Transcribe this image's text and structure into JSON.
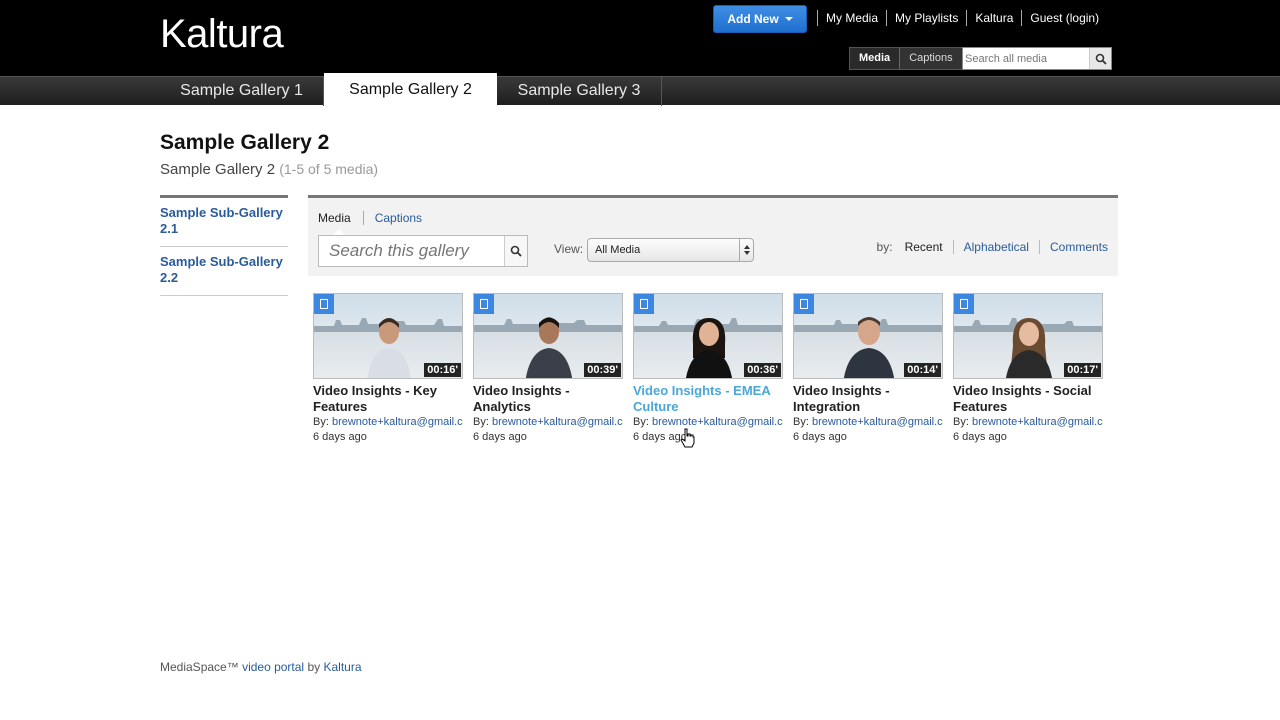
{
  "header": {
    "logo": "Kaltura",
    "add_new_label": "Add New",
    "links": [
      "My Media",
      "My Playlists",
      "Kaltura",
      "Guest (login)"
    ],
    "search_tabs": [
      "Media",
      "Captions"
    ],
    "search_placeholder": "Search all media"
  },
  "gallery_tabs": [
    "Sample Gallery 1",
    "Sample Gallery 2",
    "Sample Gallery 3"
  ],
  "page": {
    "title": "Sample Gallery 2",
    "subtitle": "Sample Gallery 2",
    "count": "(1-5 of 5 media)"
  },
  "sidebar": {
    "items": [
      "Sample Sub-Gallery 2.1",
      "Sample Sub-Gallery 2.2"
    ]
  },
  "toolbar": {
    "tabs": [
      "Media",
      "Captions"
    ],
    "search_placeholder": "Search this gallery",
    "view_label": "View:",
    "view_value": "All Media",
    "sort_label": "by:",
    "sort_options": [
      "Recent",
      "Alphabetical",
      "Comments"
    ]
  },
  "media": [
    {
      "title": "Video Insights - Key Features",
      "duration": "00:16'",
      "by_label": "By:",
      "author": "brewnote+kaltura@gmail.com",
      "ago": "6 days ago"
    },
    {
      "title": "Video Insights - Analytics",
      "duration": "00:39'",
      "by_label": "By:",
      "author": "brewnote+kaltura@gmail.com",
      "ago": "6 days ago"
    },
    {
      "title": "Video Insights - EMEA Culture",
      "duration": "00:36'",
      "by_label": "By:",
      "author": "brewnote+kaltura@gmail.com",
      "ago": "6 days ago"
    },
    {
      "title": "Video Insights - Integration",
      "duration": "00:14'",
      "by_label": "By:",
      "author": "brewnote+kaltura@gmail.com",
      "ago": "6 days ago"
    },
    {
      "title": "Video Insights - Social Features",
      "duration": "00:17'",
      "by_label": "By:",
      "author": "brewnote+kaltura@gmail.com",
      "ago": "6 days ago"
    }
  ],
  "footer": {
    "prefix": "MediaSpace™",
    "link1": "video portal",
    "middle": "by",
    "link2": "Kaltura"
  },
  "colors": {
    "accent": "#3d87e0",
    "link": "#2a5c9a",
    "hover_title": "#4aa7d6"
  }
}
